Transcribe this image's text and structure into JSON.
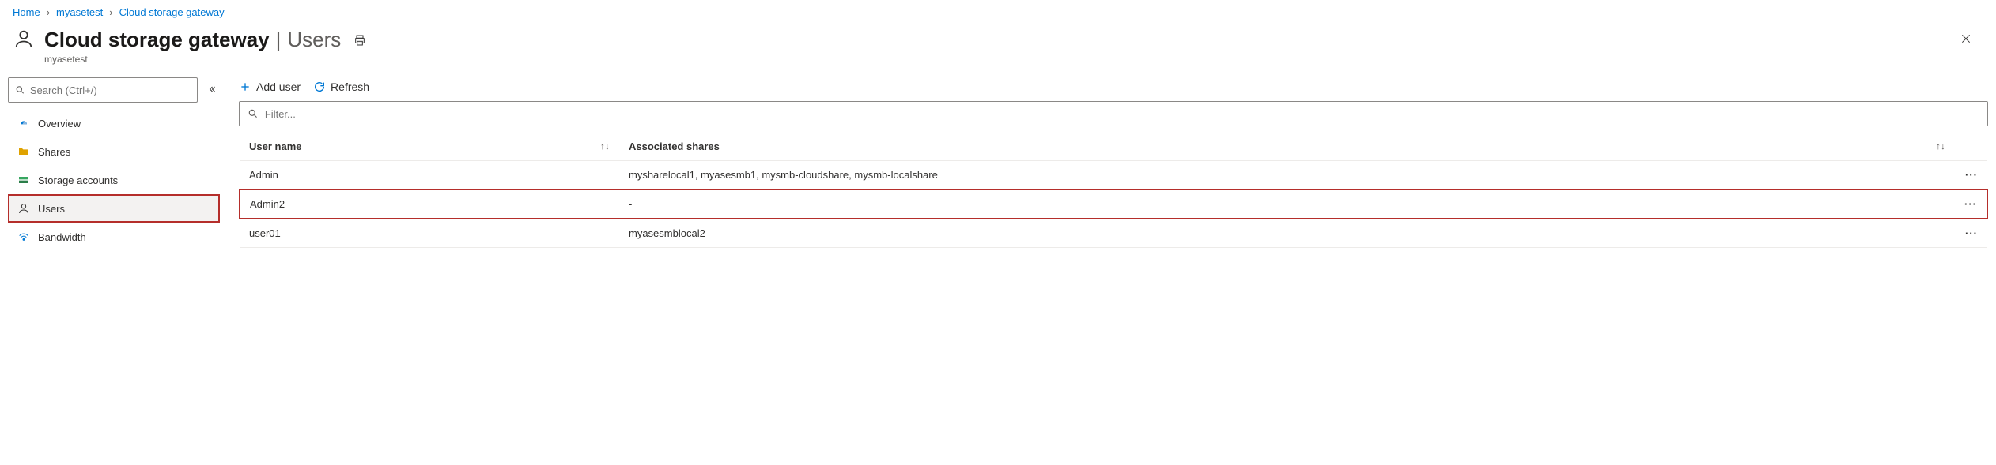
{
  "breadcrumb": {
    "items": [
      {
        "label": "Home"
      },
      {
        "label": "myasetest"
      },
      {
        "label": "Cloud storage gateway"
      }
    ]
  },
  "header": {
    "title_main": "Cloud storage gateway",
    "title_separator": "|",
    "title_section": "Users",
    "subtitle": "myasetest"
  },
  "left": {
    "search_placeholder": "Search (Ctrl+/)",
    "nav": [
      {
        "key": "overview",
        "label": "Overview",
        "icon": "overview"
      },
      {
        "key": "shares",
        "label": "Shares",
        "icon": "folder"
      },
      {
        "key": "storage",
        "label": "Storage accounts",
        "icon": "storage"
      },
      {
        "key": "users",
        "label": "Users",
        "icon": "user",
        "active": true
      },
      {
        "key": "bandwidth",
        "label": "Bandwidth",
        "icon": "bandwidth"
      }
    ]
  },
  "commands": {
    "add_user": "Add user",
    "refresh": "Refresh"
  },
  "filter": {
    "placeholder": "Filter..."
  },
  "table": {
    "columns": [
      {
        "key": "user",
        "label": "User name"
      },
      {
        "key": "shares",
        "label": "Associated shares"
      }
    ],
    "rows": [
      {
        "user": "Admin",
        "shares": "mysharelocal1, myasesmb1, mysmb-cloudshare, mysmb-localshare",
        "highlight": false
      },
      {
        "user": "Admin2",
        "shares": "-",
        "highlight": true
      },
      {
        "user": "user01",
        "shares": "myasesmblocal2",
        "highlight": false
      }
    ]
  }
}
